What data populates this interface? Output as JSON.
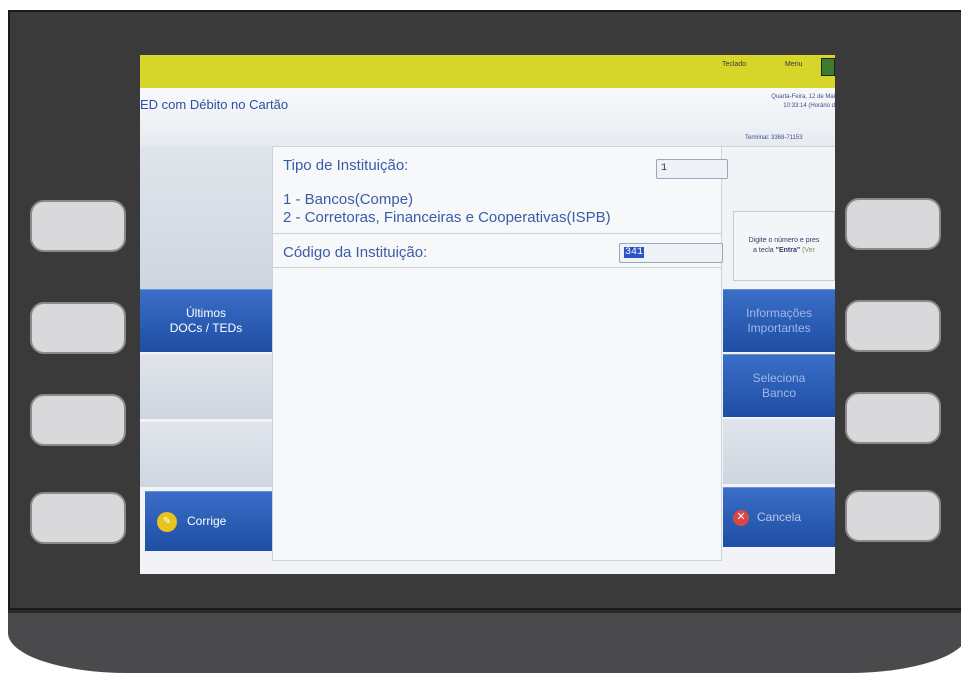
{
  "top_bar": {
    "teclado": "Teclado",
    "menu": "Menu"
  },
  "header": {
    "title": "ED com Débito no Cartão",
    "datetime_line1": "Quarta-Feira, 12 de Mai",
    "datetime_line2": "10:33:14 (Horário d",
    "terminal": "Terminal: 3368-71153"
  },
  "form": {
    "tipo_label": "Tipo de Instituição:",
    "tipo_value": "1",
    "option_1": "1 - Bancos(Compe)",
    "option_2": "2 - Corretoras, Financeiras e Cooperativas(ISPB)",
    "codigo_label": "Código da Instituição:",
    "codigo_value": "341"
  },
  "left_menu": {
    "ultimos_line1": "Últimos",
    "ultimos_line2": "DOCs / TEDs",
    "corrige": "Corrige"
  },
  "right_menu": {
    "hint_line1": "Digite o número e pres",
    "hint_line2_prefix": "a tecla ",
    "hint_bold": "\"Entra\"",
    "hint_suffix": " (Ver",
    "informacoes_line1": "Informações",
    "informacoes_line2": "Importantes",
    "seleciona_line1": "Seleciona",
    "seleciona_line2": "Banco",
    "cancela": "Cancela"
  },
  "colors": {
    "yellow_bar": "#d6d52a",
    "button_blue": "#2a5cb8",
    "label_blue": "#3a5ba8",
    "bezel": "#3a3a3a"
  }
}
